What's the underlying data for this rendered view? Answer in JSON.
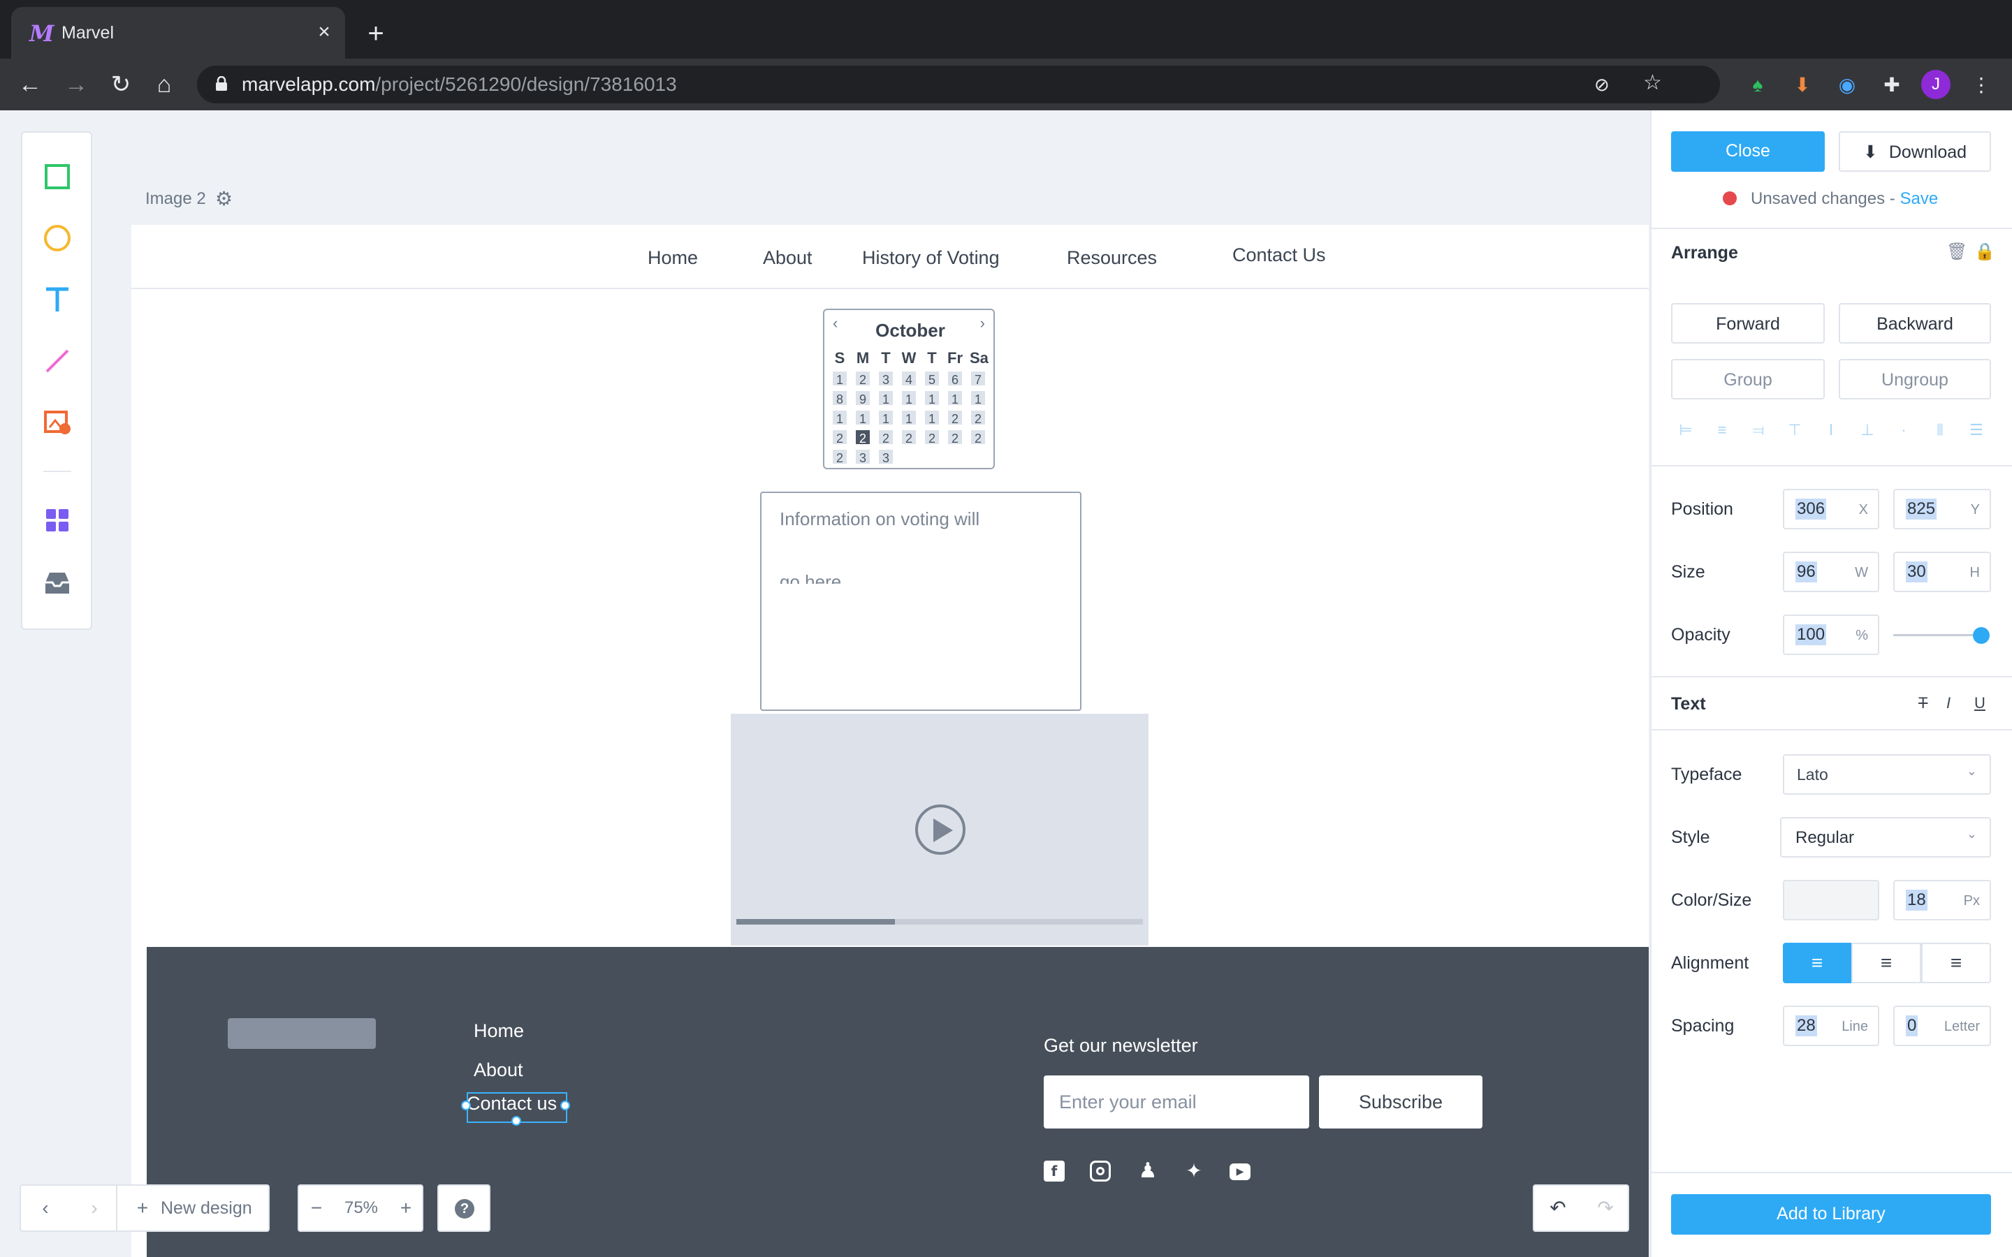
{
  "browser": {
    "tab_title": "Marvel",
    "favicon": "marvel-logo",
    "url_host": "marvelapp.com",
    "url_path": "/project/5261290/design/73816013",
    "profile_initial": "J"
  },
  "canvas": {
    "image_label": "Image 2",
    "topnav": [
      "Home",
      "About",
      "History of Voting",
      "Resources",
      "Contact Us"
    ],
    "calendar": {
      "month": "October",
      "day_headers": [
        "S",
        "M",
        "T",
        "W",
        "T",
        "Fr",
        "Sa"
      ],
      "days": [
        "1",
        "2",
        "3",
        "4",
        "5",
        "6",
        "7",
        "8",
        "9",
        "1",
        "1",
        "1",
        "1",
        "1",
        "1",
        "1",
        "1",
        "1",
        "1",
        "2",
        "2",
        "2",
        "2",
        "2",
        "2",
        "2",
        "2",
        "2",
        "2",
        "3",
        "3"
      ],
      "selected_day_index": 22
    },
    "info_text_line1": "Information on voting will",
    "info_text_line2": "go here",
    "video_progress": 0.39
  },
  "footer": {
    "links": [
      "Home",
      "About",
      "Contact us"
    ],
    "newsletter_heading": "Get our newsletter",
    "email_placeholder": "Enter your email",
    "subscribe_label": "Subscribe",
    "social_icons": [
      "facebook-icon",
      "instagram-icon",
      "snapchat-icon",
      "twitter-icon",
      "youtube-icon"
    ]
  },
  "bottom_controls": {
    "new_design_label": "New design",
    "zoom_level": "75%"
  },
  "panel": {
    "close_label": "Close",
    "download_label": "Download",
    "unsaved_text": "Unsaved changes - ",
    "save_link": "Save",
    "arrange_heading": "Arrange",
    "forward_label": "Forward",
    "backward_label": "Backward",
    "group_label": "Group",
    "ungroup_label": "Ungroup",
    "position_label": "Position",
    "position_x": "306",
    "position_y": "825",
    "size_label": "Size",
    "size_w": "96",
    "size_h": "30",
    "opacity_label": "Opacity",
    "opacity_value": "100",
    "opacity_level": 1.0,
    "text_heading": "Text",
    "typeface_label": "Typeface",
    "typeface_value": "Lato",
    "style_label": "Style",
    "style_value": "Regular",
    "colorsize_label": "Color/Size",
    "font_size_value": "18",
    "alignment_label": "Alignment",
    "spacing_label": "Spacing",
    "line_spacing": "28",
    "letter_spacing": "0",
    "units": {
      "x": "X",
      "y": "Y",
      "w": "W",
      "h": "H",
      "pct": "%",
      "px": "Px",
      "line": "Line",
      "letter": "Letter"
    },
    "add_library_label": "Add to Library"
  },
  "colors": {
    "accent": "#2eaaf5",
    "unsaved_dot": "#e5484d",
    "footer_bg": "#474f5a"
  }
}
